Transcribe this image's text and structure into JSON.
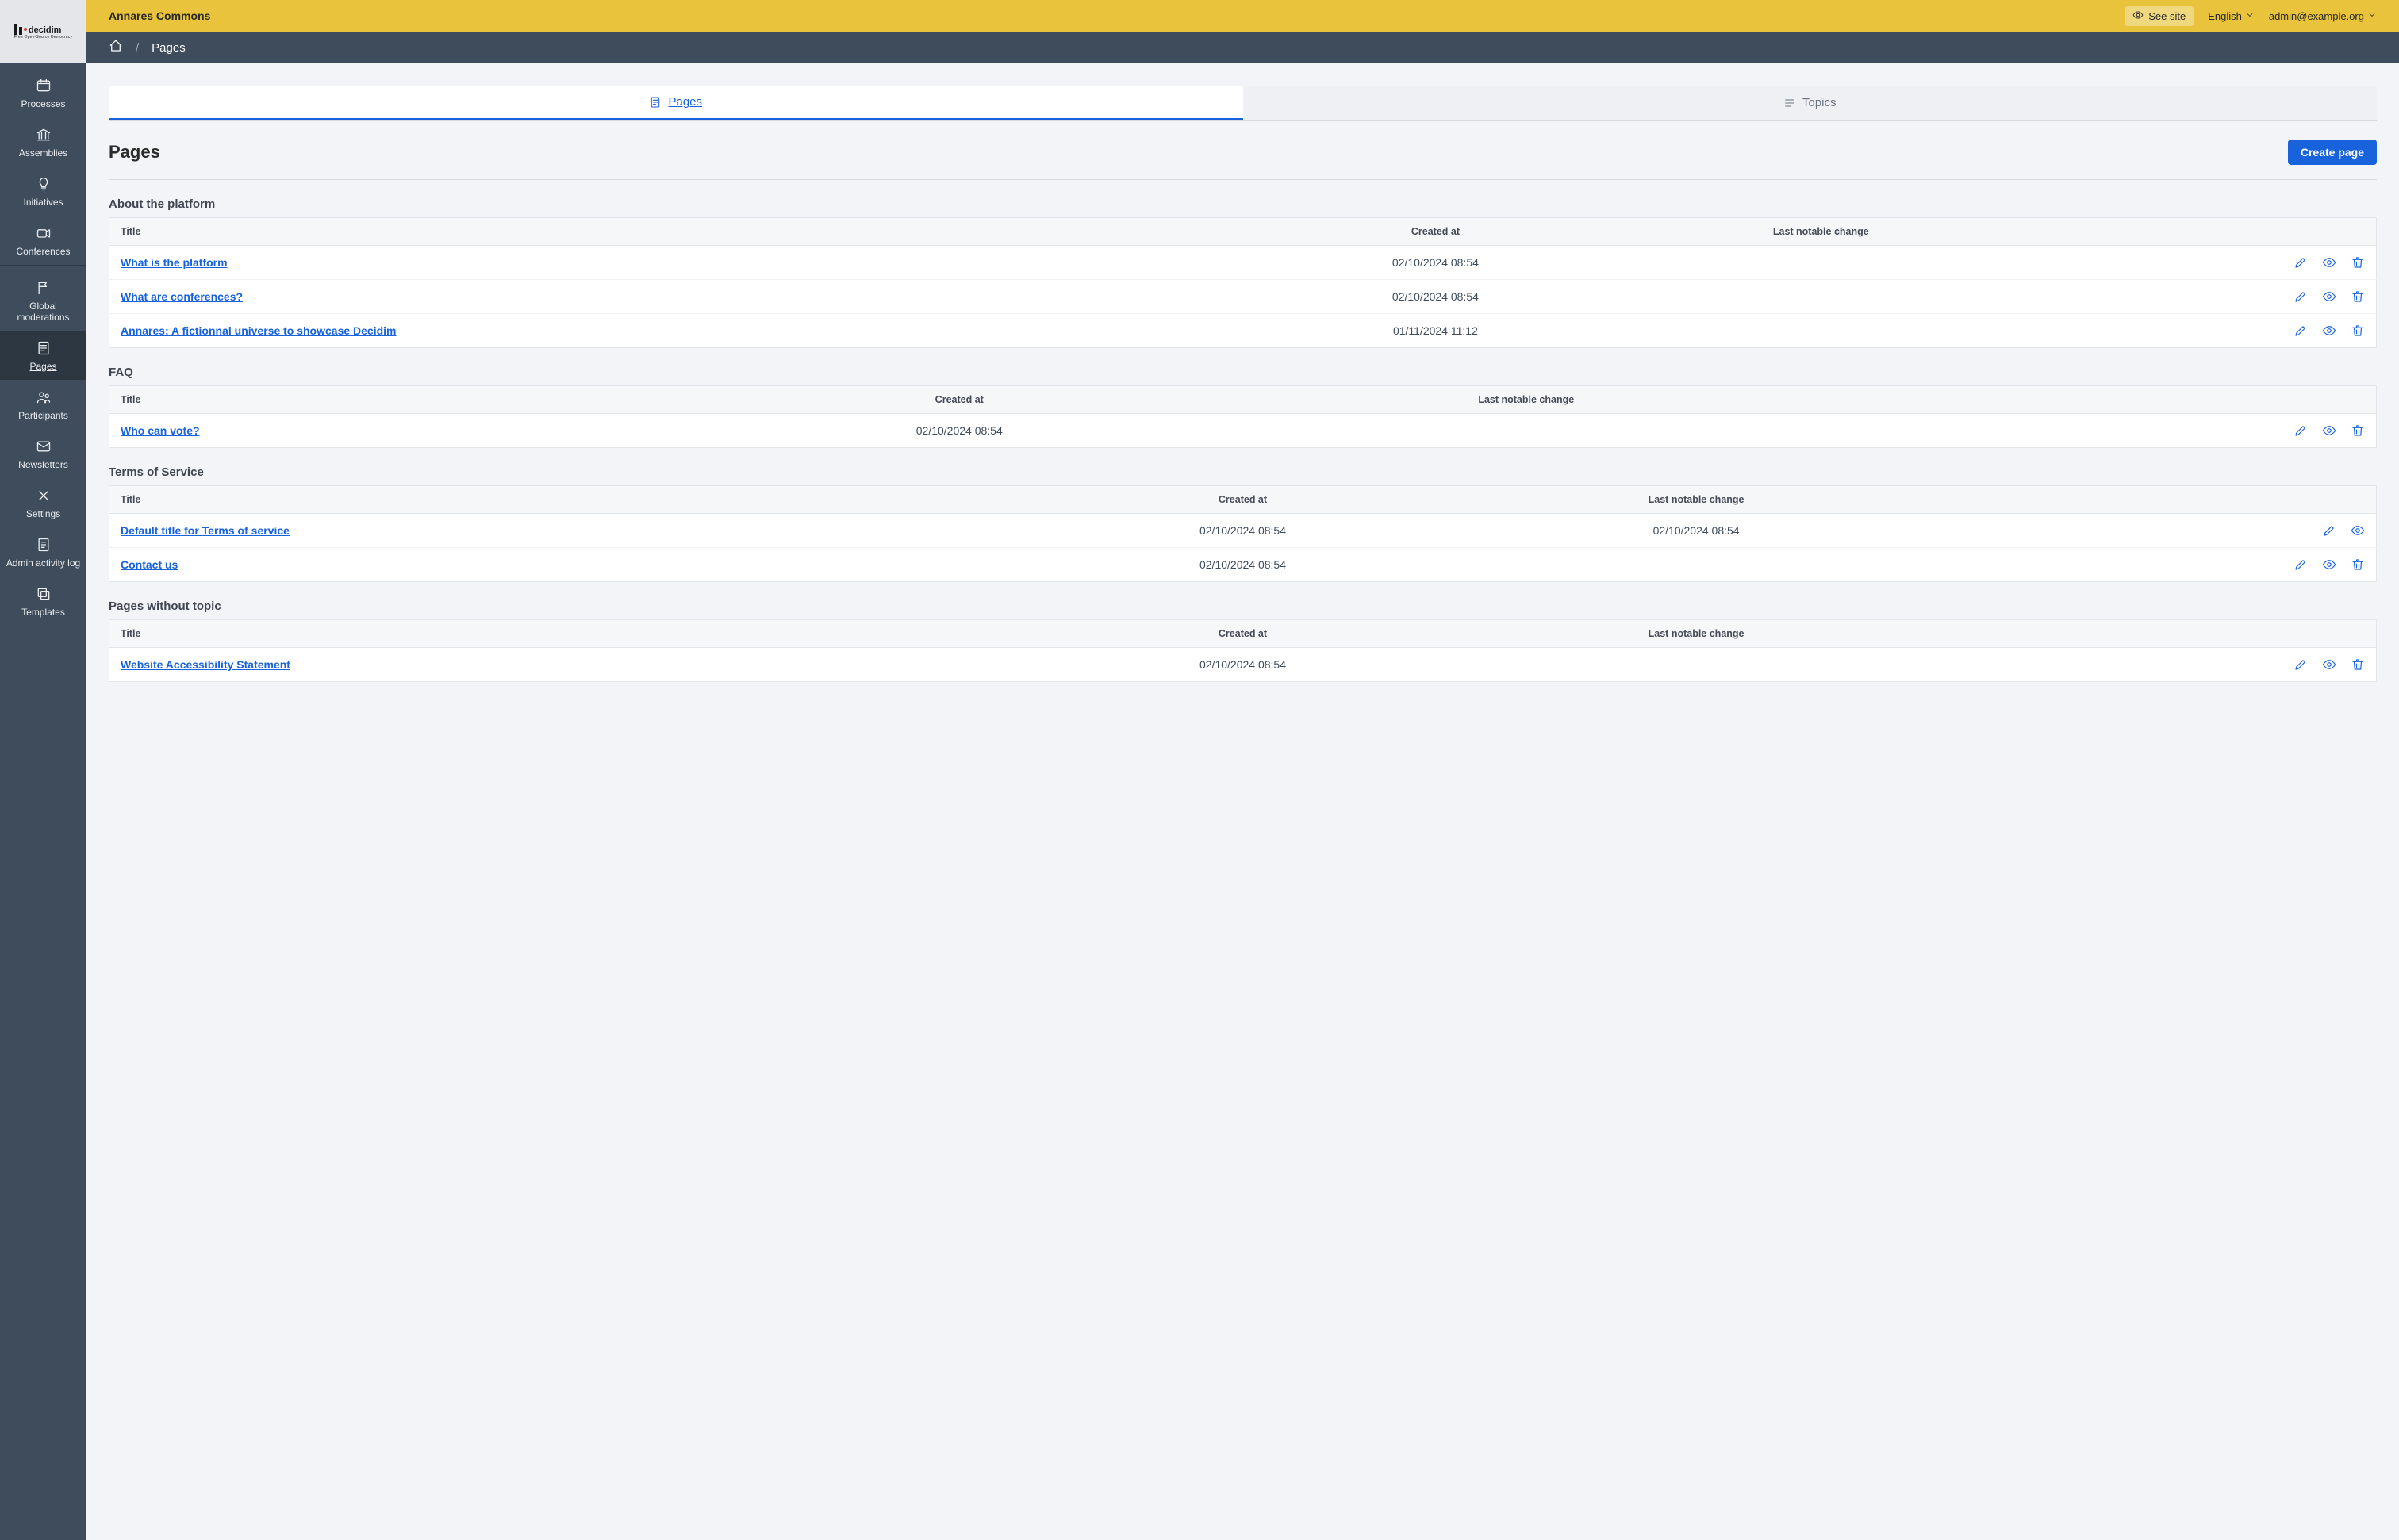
{
  "logo": {
    "name": "decidim",
    "tagline": "Free Open-Source Democracy"
  },
  "sidebar": {
    "groups": [
      {
        "items": [
          {
            "id": "processes",
            "label": "Processes",
            "icon": "calendar-flag-icon"
          },
          {
            "id": "assemblies",
            "label": "Assemblies",
            "icon": "bank-icon"
          },
          {
            "id": "initiatives",
            "label": "Initiatives",
            "icon": "lightbulb-icon"
          },
          {
            "id": "conferences",
            "label": "Conferences",
            "icon": "camera-icon"
          }
        ]
      },
      {
        "items": [
          {
            "id": "global-moderations",
            "label": "Global moderations",
            "icon": "flag-icon"
          },
          {
            "id": "pages",
            "label": "Pages",
            "icon": "page-icon",
            "active": true
          },
          {
            "id": "participants",
            "label": "Participants",
            "icon": "people-icon"
          },
          {
            "id": "newsletters",
            "label": "Newsletters",
            "icon": "mail-icon"
          },
          {
            "id": "settings",
            "label": "Settings",
            "icon": "tools-icon"
          },
          {
            "id": "admin-activity-log",
            "label": "Admin activity log",
            "icon": "document-icon"
          },
          {
            "id": "templates",
            "label": "Templates",
            "icon": "copy-icon"
          }
        ]
      }
    ]
  },
  "topbar": {
    "org": "Annares Commons",
    "see_site": "See site",
    "language": "English",
    "user": "admin@example.org"
  },
  "breadcrumb": {
    "home_aria": "Home",
    "current": "Pages"
  },
  "tabs": {
    "pages": "Pages",
    "topics": "Topics"
  },
  "page": {
    "title": "Pages",
    "create_button": "Create page"
  },
  "columns": {
    "title": "Title",
    "created_at": "Created at",
    "last_change": "Last notable change"
  },
  "sections": [
    {
      "id": "about",
      "title": "About the platform",
      "table_class": "t-about",
      "rows": [
        {
          "title": "What is the platform",
          "created": "02/10/2024 08:54",
          "changed": "",
          "actions": [
            "edit",
            "preview",
            "delete"
          ]
        },
        {
          "title": "What are conferences?",
          "created": "02/10/2024 08:54",
          "changed": "",
          "actions": [
            "edit",
            "preview",
            "delete"
          ]
        },
        {
          "title": "Annares: A fictionnal universe to showcase Decidim",
          "created": "01/11/2024 11:12",
          "changed": "",
          "actions": [
            "edit",
            "preview",
            "delete"
          ]
        }
      ]
    },
    {
      "id": "faq",
      "title": "FAQ",
      "table_class": "t-faq",
      "rows": [
        {
          "title": "Who can vote?",
          "created": "02/10/2024 08:54",
          "changed": "",
          "actions": [
            "edit",
            "preview",
            "delete"
          ]
        }
      ]
    },
    {
      "id": "tos",
      "title": "Terms of Service",
      "table_class": "t-tos",
      "rows": [
        {
          "title": "Default title for Terms of service",
          "created": "02/10/2024 08:54",
          "changed": "02/10/2024 08:54",
          "actions": [
            "edit",
            "preview"
          ]
        },
        {
          "title": "Contact us",
          "created": "02/10/2024 08:54",
          "changed": "",
          "actions": [
            "edit",
            "preview",
            "delete"
          ]
        }
      ]
    },
    {
      "id": "notopic",
      "title": "Pages without topic",
      "table_class": "t-notopic",
      "rows": [
        {
          "title": "Website Accessibility Statement",
          "created": "02/10/2024 08:54",
          "changed": "",
          "actions": [
            "edit",
            "preview",
            "delete"
          ]
        }
      ]
    }
  ]
}
